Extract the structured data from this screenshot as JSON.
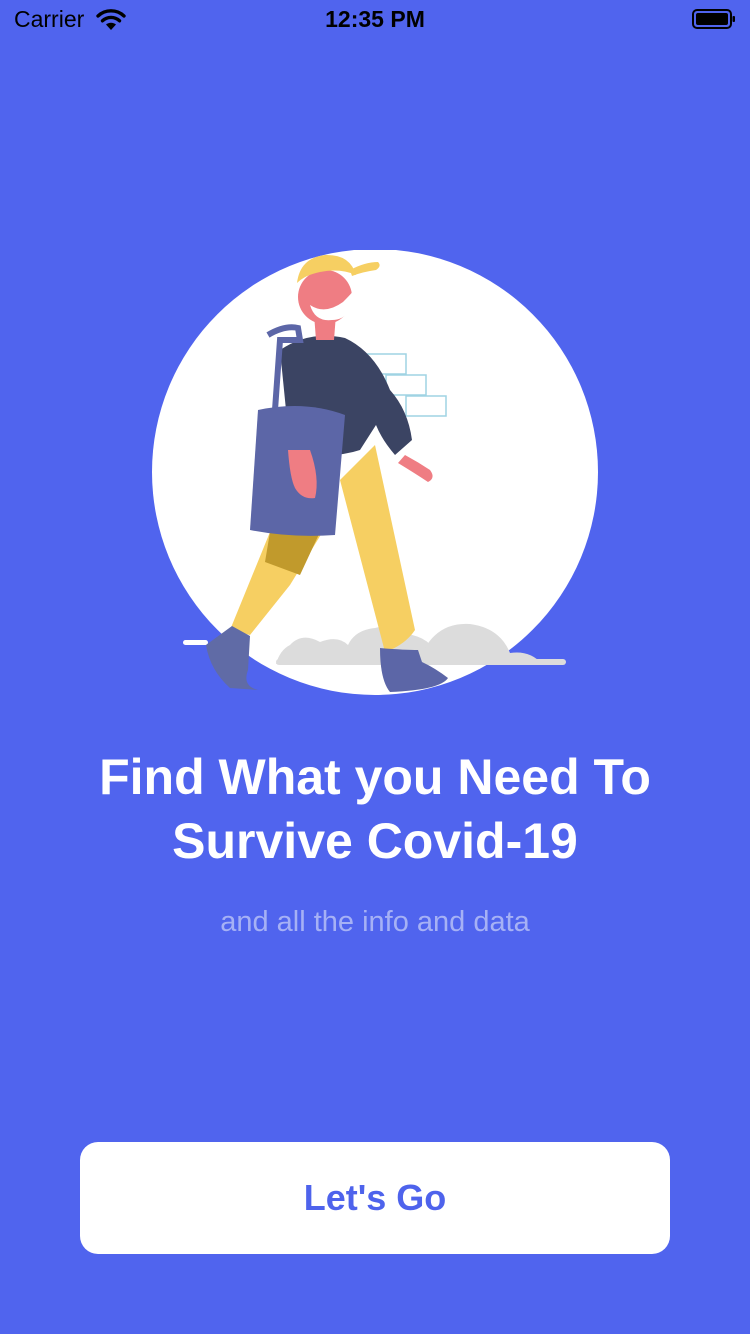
{
  "status_bar": {
    "carrier": "Carrier",
    "time": "12:35 PM",
    "wifi_icon": "wifi-icon",
    "battery_icon": "battery-icon"
  },
  "onboarding": {
    "illustration": "walking-person-with-mask-illustration",
    "headline": "Find What you Need To Survive Covid-19",
    "subtitle": "and all the info and data",
    "button_label": "Let's Go"
  },
  "colors": {
    "background": "#5064EE",
    "button_bg": "#FFFFFF",
    "button_text": "#4E63EC",
    "subtitle": "#A6B1F5"
  }
}
